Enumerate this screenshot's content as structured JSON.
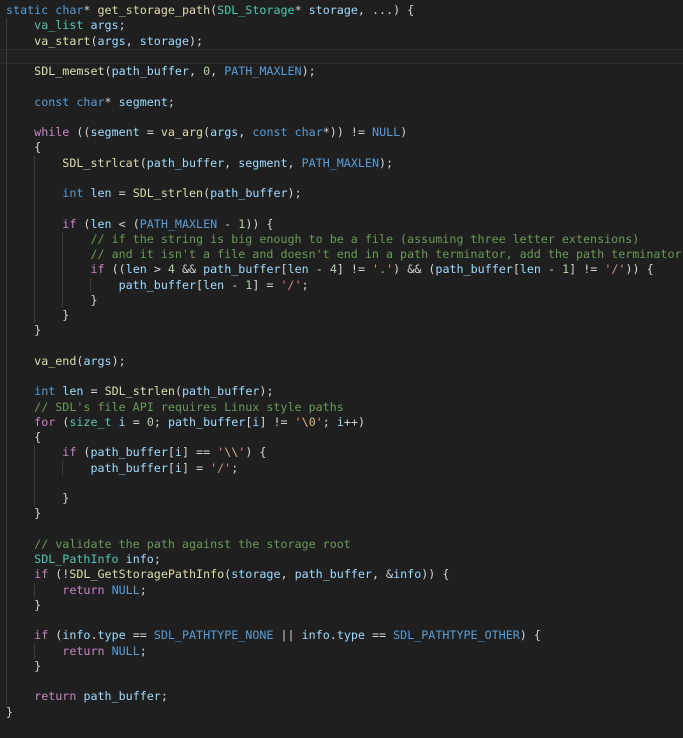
{
  "colors": {
    "background": "#1f1f1f",
    "keyword": "#569cd6",
    "control": "#c586c0",
    "type": "#4ec9b0",
    "function": "#dcdcaa",
    "variable": "#9cdcfe",
    "number": "#b5cea8",
    "string": "#ce9178",
    "comment": "#6a9955",
    "plain": "#d4d4d4"
  },
  "code": {
    "lines": [
      [
        [
          "static",
          "k"
        ],
        [
          " ",
          "p"
        ],
        [
          "char",
          "k"
        ],
        [
          "* ",
          "p"
        ],
        [
          "get_storage_path",
          "f"
        ],
        [
          "(",
          "p"
        ],
        [
          "SDL_Storage",
          "t"
        ],
        [
          "* ",
          "p"
        ],
        [
          "storage",
          "v"
        ],
        [
          ", ...) {",
          "p"
        ]
      ],
      [
        [
          "    ",
          "p"
        ],
        [
          "va_list",
          "t"
        ],
        [
          " ",
          "p"
        ],
        [
          "args",
          "v"
        ],
        [
          ";",
          "p"
        ]
      ],
      [
        [
          "    ",
          "p"
        ],
        [
          "va_start",
          "f"
        ],
        [
          "(",
          "p"
        ],
        [
          "args",
          "v"
        ],
        [
          ", ",
          "p"
        ],
        [
          "storage",
          "v"
        ],
        [
          ");",
          "p"
        ]
      ],
      [
        [
          "",
          "p"
        ]
      ],
      [
        [
          "    ",
          "p"
        ],
        [
          "SDL_memset",
          "f"
        ],
        [
          "(",
          "p"
        ],
        [
          "path_buffer",
          "v"
        ],
        [
          ", ",
          "p"
        ],
        [
          "0",
          "n"
        ],
        [
          ", ",
          "p"
        ],
        [
          "PATH_MAXLEN",
          "M"
        ],
        [
          ");",
          "p"
        ]
      ],
      [
        [
          "",
          "p"
        ]
      ],
      [
        [
          "    ",
          "p"
        ],
        [
          "const",
          "k"
        ],
        [
          " ",
          "p"
        ],
        [
          "char",
          "k"
        ],
        [
          "* ",
          "p"
        ],
        [
          "segment",
          "v"
        ],
        [
          ";",
          "p"
        ]
      ],
      [
        [
          "",
          "p"
        ]
      ],
      [
        [
          "    ",
          "p"
        ],
        [
          "while",
          "c"
        ],
        [
          " ((",
          "p"
        ],
        [
          "segment",
          "v"
        ],
        [
          " = ",
          "p"
        ],
        [
          "va_arg",
          "f"
        ],
        [
          "(",
          "p"
        ],
        [
          "args",
          "v"
        ],
        [
          ", ",
          "p"
        ],
        [
          "const",
          "k"
        ],
        [
          " ",
          "p"
        ],
        [
          "char",
          "k"
        ],
        [
          "*)) != ",
          "p"
        ],
        [
          "NULL",
          "M"
        ],
        [
          ")",
          "p"
        ]
      ],
      [
        [
          "    {",
          "p"
        ]
      ],
      [
        [
          "        ",
          "p"
        ],
        [
          "SDL_strlcat",
          "f"
        ],
        [
          "(",
          "p"
        ],
        [
          "path_buffer",
          "v"
        ],
        [
          ", ",
          "p"
        ],
        [
          "segment",
          "v"
        ],
        [
          ", ",
          "p"
        ],
        [
          "PATH_MAXLEN",
          "M"
        ],
        [
          ");",
          "p"
        ]
      ],
      [
        [
          "",
          "p"
        ]
      ],
      [
        [
          "        ",
          "p"
        ],
        [
          "int",
          "k"
        ],
        [
          " ",
          "p"
        ],
        [
          "len",
          "v"
        ],
        [
          " = ",
          "p"
        ],
        [
          "SDL_strlen",
          "f"
        ],
        [
          "(",
          "p"
        ],
        [
          "path_buffer",
          "v"
        ],
        [
          ");",
          "p"
        ]
      ],
      [
        [
          "",
          "p"
        ]
      ],
      [
        [
          "        ",
          "p"
        ],
        [
          "if",
          "c"
        ],
        [
          " (",
          "p"
        ],
        [
          "len",
          "v"
        ],
        [
          " < (",
          "p"
        ],
        [
          "PATH_MAXLEN",
          "M"
        ],
        [
          " - ",
          "p"
        ],
        [
          "1",
          "n"
        ],
        [
          ")) {",
          "p"
        ]
      ],
      [
        [
          "            ",
          "p"
        ],
        [
          "// if the string is big enough to be a file (assuming three letter extensions)",
          "m"
        ]
      ],
      [
        [
          "            ",
          "p"
        ],
        [
          "// and it isn't a file and doesn't end in a path terminator, add the path terminator.",
          "m"
        ]
      ],
      [
        [
          "            ",
          "p"
        ],
        [
          "if",
          "c"
        ],
        [
          " ((",
          "p"
        ],
        [
          "len",
          "v"
        ],
        [
          " > ",
          "p"
        ],
        [
          "4",
          "n"
        ],
        [
          " && ",
          "p"
        ],
        [
          "path_buffer",
          "v"
        ],
        [
          "[",
          "p"
        ],
        [
          "len",
          "v"
        ],
        [
          " - ",
          "p"
        ],
        [
          "4",
          "n"
        ],
        [
          "] != ",
          "p"
        ],
        [
          "'.'",
          "s"
        ],
        [
          ") && (",
          "p"
        ],
        [
          "path_buffer",
          "v"
        ],
        [
          "[",
          "p"
        ],
        [
          "len",
          "v"
        ],
        [
          " - ",
          "p"
        ],
        [
          "1",
          "n"
        ],
        [
          "] != ",
          "p"
        ],
        [
          "'/'",
          "s"
        ],
        [
          ")) {",
          "p"
        ]
      ],
      [
        [
          "                ",
          "p"
        ],
        [
          "path_buffer",
          "v"
        ],
        [
          "[",
          "p"
        ],
        [
          "len",
          "v"
        ],
        [
          " - ",
          "p"
        ],
        [
          "1",
          "n"
        ],
        [
          "] = ",
          "p"
        ],
        [
          "'/'",
          "s"
        ],
        [
          ";",
          "p"
        ]
      ],
      [
        [
          "            }",
          "p"
        ]
      ],
      [
        [
          "        }",
          "p"
        ]
      ],
      [
        [
          "    }",
          "p"
        ]
      ],
      [
        [
          "",
          "p"
        ]
      ],
      [
        [
          "    ",
          "p"
        ],
        [
          "va_end",
          "f"
        ],
        [
          "(",
          "p"
        ],
        [
          "args",
          "v"
        ],
        [
          ");",
          "p"
        ]
      ],
      [
        [
          "",
          "p"
        ]
      ],
      [
        [
          "    ",
          "p"
        ],
        [
          "int",
          "k"
        ],
        [
          " ",
          "p"
        ],
        [
          "len",
          "v"
        ],
        [
          " = ",
          "p"
        ],
        [
          "SDL_strlen",
          "f"
        ],
        [
          "(",
          "p"
        ],
        [
          "path_buffer",
          "v"
        ],
        [
          ");",
          "p"
        ]
      ],
      [
        [
          "    ",
          "p"
        ],
        [
          "// SDL's file API requires Linux style paths",
          "m"
        ]
      ],
      [
        [
          "    ",
          "p"
        ],
        [
          "for",
          "c"
        ],
        [
          " (",
          "p"
        ],
        [
          "size_t",
          "t"
        ],
        [
          " ",
          "p"
        ],
        [
          "i",
          "v"
        ],
        [
          " = ",
          "p"
        ],
        [
          "0",
          "n"
        ],
        [
          "; ",
          "p"
        ],
        [
          "path_buffer",
          "v"
        ],
        [
          "[",
          "p"
        ],
        [
          "i",
          "v"
        ],
        [
          "] != ",
          "p"
        ],
        [
          "'",
          "s"
        ],
        [
          "\\0",
          "e"
        ],
        [
          "'",
          "s"
        ],
        [
          "; ",
          "p"
        ],
        [
          "i",
          "v"
        ],
        [
          "++)",
          "p"
        ]
      ],
      [
        [
          "    {",
          "p"
        ]
      ],
      [
        [
          "        ",
          "p"
        ],
        [
          "if",
          "c"
        ],
        [
          " (",
          "p"
        ],
        [
          "path_buffer",
          "v"
        ],
        [
          "[",
          "p"
        ],
        [
          "i",
          "v"
        ],
        [
          "] == ",
          "p"
        ],
        [
          "'",
          "s"
        ],
        [
          "\\\\",
          "e"
        ],
        [
          "'",
          "s"
        ],
        [
          ") {",
          "p"
        ]
      ],
      [
        [
          "            ",
          "p"
        ],
        [
          "path_buffer",
          "v"
        ],
        [
          "[",
          "p"
        ],
        [
          "i",
          "v"
        ],
        [
          "] = ",
          "p"
        ],
        [
          "'/'",
          "s"
        ],
        [
          ";",
          "p"
        ]
      ],
      [
        [
          "",
          "p"
        ]
      ],
      [
        [
          "        }",
          "p"
        ]
      ],
      [
        [
          "    }",
          "p"
        ]
      ],
      [
        [
          "",
          "p"
        ]
      ],
      [
        [
          "    ",
          "p"
        ],
        [
          "// validate the path against the storage root",
          "m"
        ]
      ],
      [
        [
          "    ",
          "p"
        ],
        [
          "SDL_PathInfo",
          "t"
        ],
        [
          " ",
          "p"
        ],
        [
          "info",
          "v"
        ],
        [
          ";",
          "p"
        ]
      ],
      [
        [
          "    ",
          "p"
        ],
        [
          "if",
          "c"
        ],
        [
          " (!",
          "p"
        ],
        [
          "SDL_GetStoragePathInfo",
          "f"
        ],
        [
          "(",
          "p"
        ],
        [
          "storage",
          "v"
        ],
        [
          ", ",
          "p"
        ],
        [
          "path_buffer",
          "v"
        ],
        [
          ", &",
          "p"
        ],
        [
          "info",
          "v"
        ],
        [
          ")) {",
          "p"
        ]
      ],
      [
        [
          "        ",
          "p"
        ],
        [
          "return",
          "c"
        ],
        [
          " ",
          "p"
        ],
        [
          "NULL",
          "M"
        ],
        [
          ";",
          "p"
        ]
      ],
      [
        [
          "    }",
          "p"
        ]
      ],
      [
        [
          "",
          "p"
        ]
      ],
      [
        [
          "    ",
          "p"
        ],
        [
          "if",
          "c"
        ],
        [
          " (",
          "p"
        ],
        [
          "info",
          "v"
        ],
        [
          ".",
          "p"
        ],
        [
          "type",
          "v"
        ],
        [
          " == ",
          "p"
        ],
        [
          "SDL_PATHTYPE_NONE",
          "M"
        ],
        [
          " || ",
          "p"
        ],
        [
          "info",
          "v"
        ],
        [
          ".",
          "p"
        ],
        [
          "type",
          "v"
        ],
        [
          " == ",
          "p"
        ],
        [
          "SDL_PATHTYPE_OTHER",
          "M"
        ],
        [
          ") {",
          "p"
        ]
      ],
      [
        [
          "        ",
          "p"
        ],
        [
          "return",
          "c"
        ],
        [
          " ",
          "p"
        ],
        [
          "NULL",
          "M"
        ],
        [
          ";",
          "p"
        ]
      ],
      [
        [
          "    }",
          "p"
        ]
      ],
      [
        [
          "",
          "p"
        ]
      ],
      [
        [
          "    ",
          "p"
        ],
        [
          "return",
          "c"
        ],
        [
          " ",
          "p"
        ],
        [
          "path_buffer",
          "v"
        ],
        [
          ";",
          "p"
        ]
      ],
      [
        [
          "}",
          "p"
        ]
      ]
    ],
    "current_line": 3
  }
}
